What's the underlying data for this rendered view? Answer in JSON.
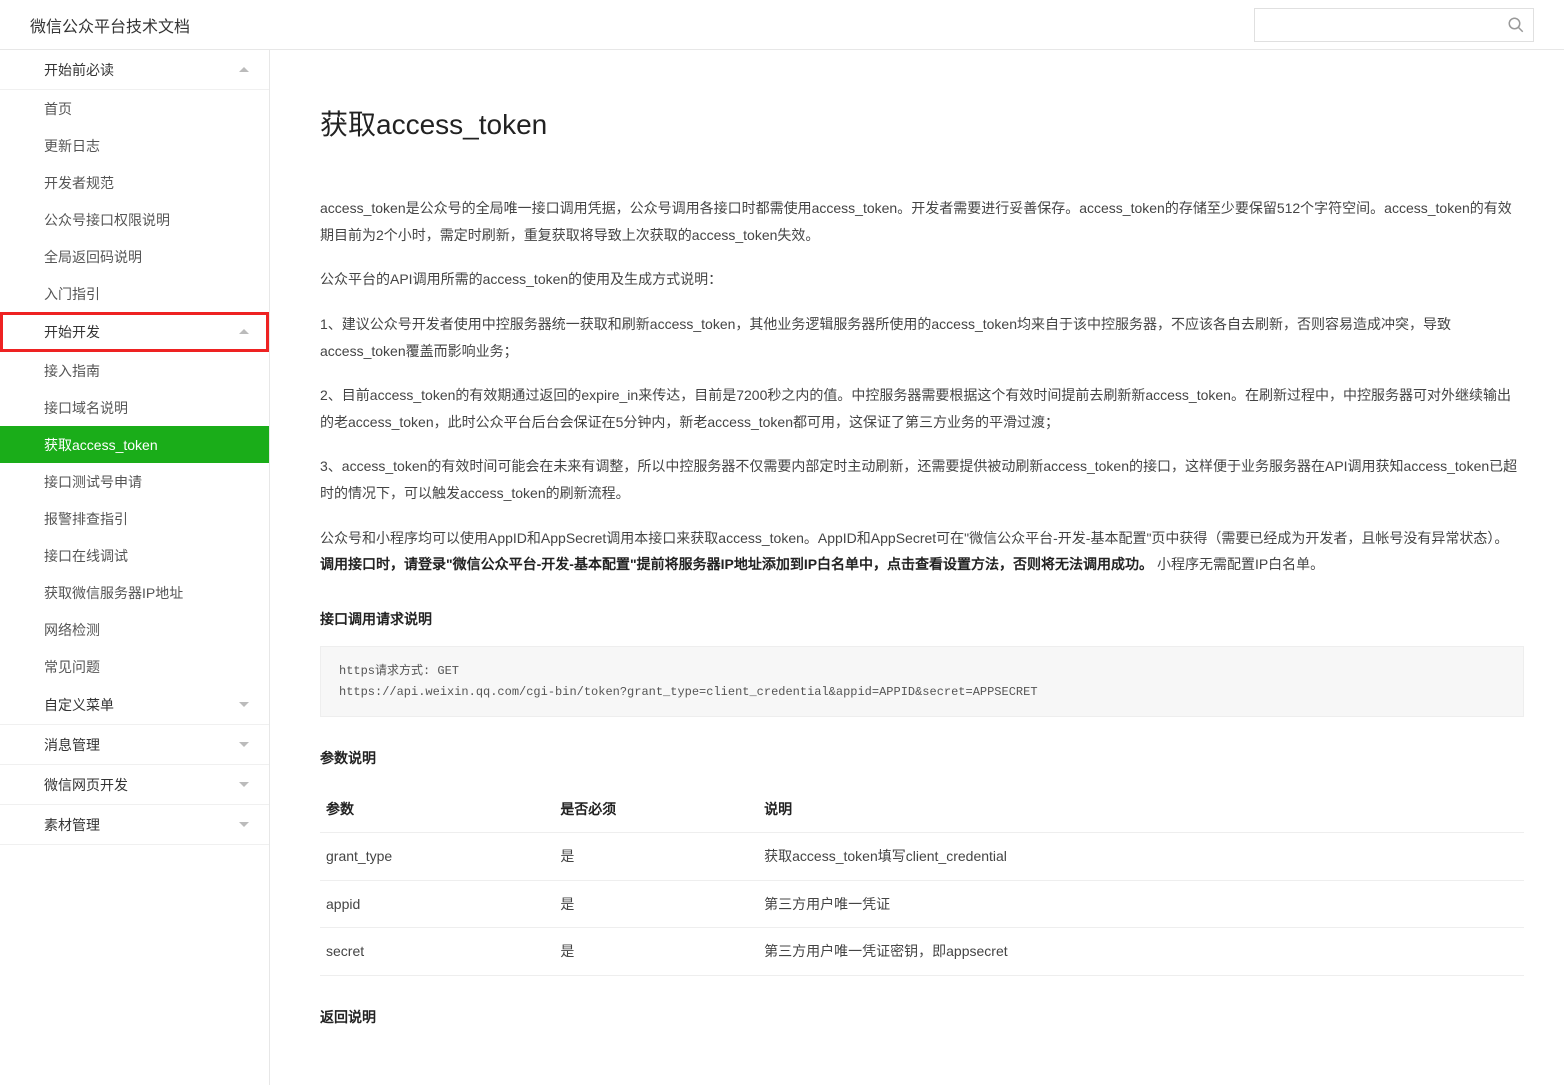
{
  "header": {
    "title": "微信公众平台技术文档",
    "search_placeholder": ""
  },
  "sidebar": {
    "groups": [
      {
        "label": "开始前必读",
        "expanded": true,
        "highlight": false,
        "items": [
          "首页",
          "更新日志",
          "开发者规范",
          "公众号接口权限说明",
          "全局返回码说明",
          "入门指引"
        ]
      },
      {
        "label": "开始开发",
        "expanded": true,
        "highlight": true,
        "items": [
          "接入指南",
          "接口域名说明",
          "获取access_token",
          "接口测试号申请",
          "报警排查指引",
          "接口在线调试",
          "获取微信服务器IP地址",
          "网络检测",
          "常见问题"
        ]
      },
      {
        "label": "自定义菜单",
        "expanded": false,
        "highlight": false,
        "items": []
      },
      {
        "label": "消息管理",
        "expanded": false,
        "highlight": false,
        "items": []
      },
      {
        "label": "微信网页开发",
        "expanded": false,
        "highlight": false,
        "items": []
      },
      {
        "label": "素材管理",
        "expanded": false,
        "highlight": false,
        "items": []
      }
    ],
    "active_item": "获取access_token"
  },
  "content": {
    "title": "获取access_token",
    "p1": "access_token是公众号的全局唯一接口调用凭据，公众号调用各接口时都需使用access_token。开发者需要进行妥善保存。access_token的存储至少要保留512个字符空间。access_token的有效期目前为2个小时，需定时刷新，重复获取将导致上次获取的access_token失效。",
    "p2": "公众平台的API调用所需的access_token的使用及生成方式说明：",
    "p3": "1、建议公众号开发者使用中控服务器统一获取和刷新access_token，其他业务逻辑服务器所使用的access_token均来自于该中控服务器，不应该各自去刷新，否则容易造成冲突，导致access_token覆盖而影响业务；",
    "p4": "2、目前access_token的有效期通过返回的expire_in来传达，目前是7200秒之内的值。中控服务器需要根据这个有效时间提前去刷新新access_token。在刷新过程中，中控服务器可对外继续输出的老access_token，此时公众平台后台会保证在5分钟内，新老access_token都可用，这保证了第三方业务的平滑过渡；",
    "p5": "3、access_token的有效时间可能会在未来有调整，所以中控服务器不仅需要内部定时主动刷新，还需要提供被动刷新access_token的接口，这样便于业务服务器在API调用获知access_token已超时的情况下，可以触发access_token的刷新流程。",
    "p6a": "公众号和小程序均可以使用AppID和AppSecret调用本接口来获取access_token。AppID和AppSecret可在\"微信公众平台-开发-基本配置\"页中获得（需要已经成为开发者，且帐号没有异常状态）。",
    "p6b": "调用接口时，请登录\"微信公众平台-开发-基本配置\"提前将服务器IP地址添加到IP白名单中，点击查看设置方法，否则将无法调用成功。",
    "p6c": "小程序无需配置IP白名单。",
    "h_req": "接口调用请求说明",
    "code": "https请求方式: GET\nhttps://api.weixin.qq.com/cgi-bin/token?grant_type=client_credential&appid=APPID&secret=APPSECRET",
    "h_param": "参数说明",
    "param_table": {
      "headers": [
        "参数",
        "是否必须",
        "说明"
      ],
      "rows": [
        [
          "grant_type",
          "是",
          "获取access_token填写client_credential"
        ],
        [
          "appid",
          "是",
          "第三方用户唯一凭证"
        ],
        [
          "secret",
          "是",
          "第三方用户唯一凭证密钥，即appsecret"
        ]
      ]
    },
    "h_ret": "返回说明"
  }
}
